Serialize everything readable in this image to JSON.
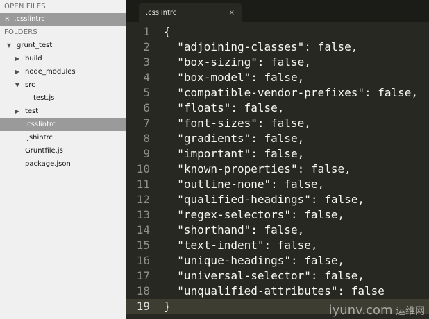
{
  "sidebar": {
    "open_files_header": "OPEN FILES",
    "open_file": {
      "close_glyph": "×",
      "name": ".csslintrc"
    },
    "folders_header": "FOLDERS",
    "tree": [
      {
        "label": "grunt_test",
        "depth": 0,
        "arrow": "down"
      },
      {
        "label": "build",
        "depth": 1,
        "arrow": "right"
      },
      {
        "label": "node_modules",
        "depth": 1,
        "arrow": "right"
      },
      {
        "label": "src",
        "depth": 1,
        "arrow": "down"
      },
      {
        "label": "test.js",
        "depth": 2,
        "arrow": "none"
      },
      {
        "label": "test",
        "depth": 1,
        "arrow": "right"
      },
      {
        "label": ".csslintrc",
        "depth": 1,
        "arrow": "none",
        "selected": true
      },
      {
        "label": ".jshintrc",
        "depth": 1,
        "arrow": "none"
      },
      {
        "label": "Gruntfile.js",
        "depth": 1,
        "arrow": "none"
      },
      {
        "label": "package.json",
        "depth": 1,
        "arrow": "none"
      }
    ]
  },
  "editor": {
    "tab": {
      "name": ".csslintrc",
      "close_glyph": "×"
    },
    "current_line": 19,
    "lines": [
      "{",
      "  \"adjoining-classes\": false,",
      "  \"box-sizing\": false,",
      "  \"box-model\": false,",
      "  \"compatible-vendor-prefixes\": false,",
      "  \"floats\": false,",
      "  \"font-sizes\": false,",
      "  \"gradients\": false,",
      "  \"important\": false,",
      "  \"known-properties\": false,",
      "  \"outline-none\": false,",
      "  \"qualified-headings\": false,",
      "  \"regex-selectors\": false,",
      "  \"shorthand\": false,",
      "  \"text-indent\": false,",
      "  \"unique-headings\": false,",
      "  \"universal-selector\": false,",
      "  \"unqualified-attributes\": false",
      "}"
    ]
  },
  "watermark": {
    "text": "iyunv.com",
    "text_cn": "运维网"
  },
  "colors": {
    "editor_bg": "#272822",
    "sidebar_bg": "#f0f0f0",
    "selection_bg": "#9a9a9a",
    "gutter_fg": "#8f908a",
    "code_fg": "#f8f8f2"
  }
}
